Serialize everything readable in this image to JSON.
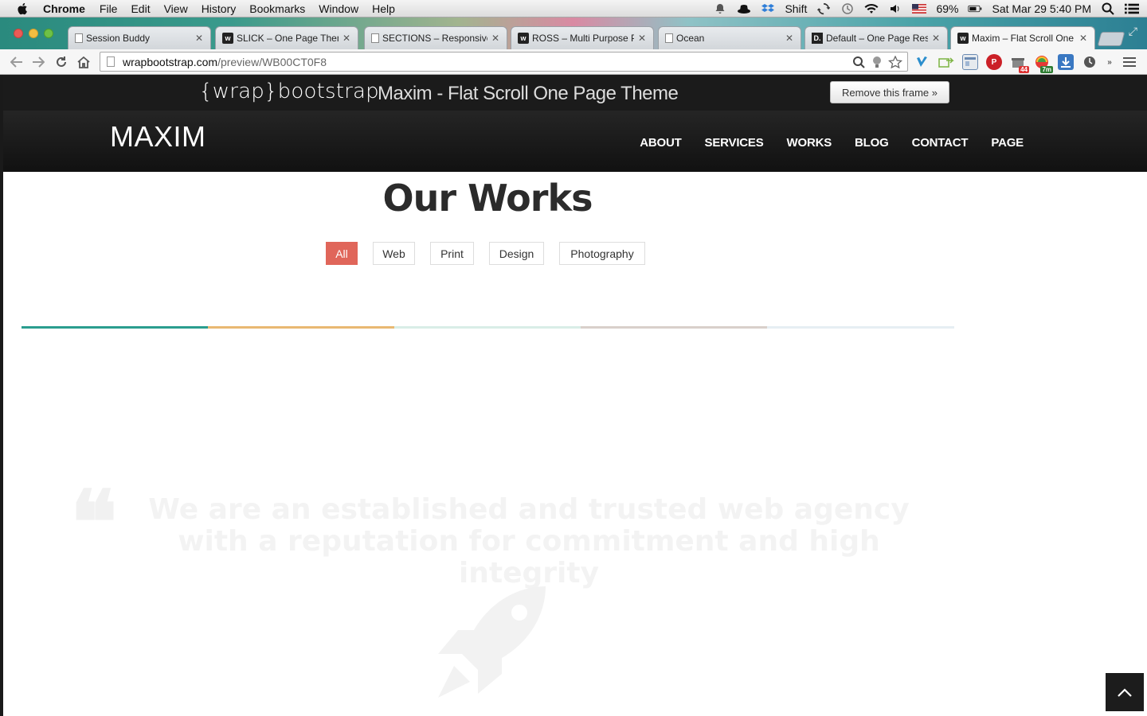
{
  "menubar": {
    "app_name": "Chrome",
    "items": [
      "File",
      "Edit",
      "View",
      "History",
      "Bookmarks",
      "Window",
      "Help"
    ],
    "status": {
      "shift_label": "Shift",
      "battery": "69%",
      "datetime": "Sat Mar 29  5:40 PM"
    }
  },
  "tabs": [
    {
      "title": "Session Buddy",
      "favicon": "session-buddy-icon",
      "active": false
    },
    {
      "title": "SLICK – One Page Theme",
      "favicon": "wrapbootstrap-icon",
      "active": false
    },
    {
      "title": "SECTIONS – Responsive",
      "favicon": "document-icon",
      "active": false
    },
    {
      "title": "ROSS – Multi Purpose Pa",
      "favicon": "wrapbootstrap-icon",
      "active": false
    },
    {
      "title": "Ocean",
      "favicon": "document-icon",
      "active": false
    },
    {
      "title": "Default – One Page Resp",
      "favicon": "d-icon",
      "active": false
    },
    {
      "title": "Maxim – Flat Scroll One P",
      "favicon": "wrapbootstrap-icon",
      "active": true
    }
  ],
  "toolbar": {
    "url_host": "wrapbootstrap.com",
    "url_path": "/preview/WB00CT0F8"
  },
  "extensions": {
    "badge_44": "44",
    "badge_7m": "7m"
  },
  "wrapbar": {
    "logo": "{wrap}bootstrap",
    "theme_title": "Maxim - Flat Scroll One Page Theme",
    "remove_frame": "Remove this frame »"
  },
  "site": {
    "logo": "MAXIM",
    "menu": [
      "ABOUT",
      "SERVICES",
      "WORKS",
      "BLOG",
      "CONTACT",
      "PAGE"
    ]
  },
  "works": {
    "title": "Our Works",
    "filters": [
      {
        "label": "All",
        "active": true
      },
      {
        "label": "Web",
        "active": false
      },
      {
        "label": "Print",
        "active": false
      },
      {
        "label": "Design",
        "active": false
      },
      {
        "label": "Photography",
        "active": false
      }
    ],
    "loader_colors": [
      "#2a9d8f",
      "#e9b872",
      "#d9ede7",
      "#d9d0cb",
      "#e6eef3"
    ]
  },
  "quote": {
    "text": "We are an established and trusted web agency with a reputation for commitment and high integrity"
  },
  "colors": {
    "accent": "#e0665a",
    "dark_bar": "#1b1b1b"
  }
}
